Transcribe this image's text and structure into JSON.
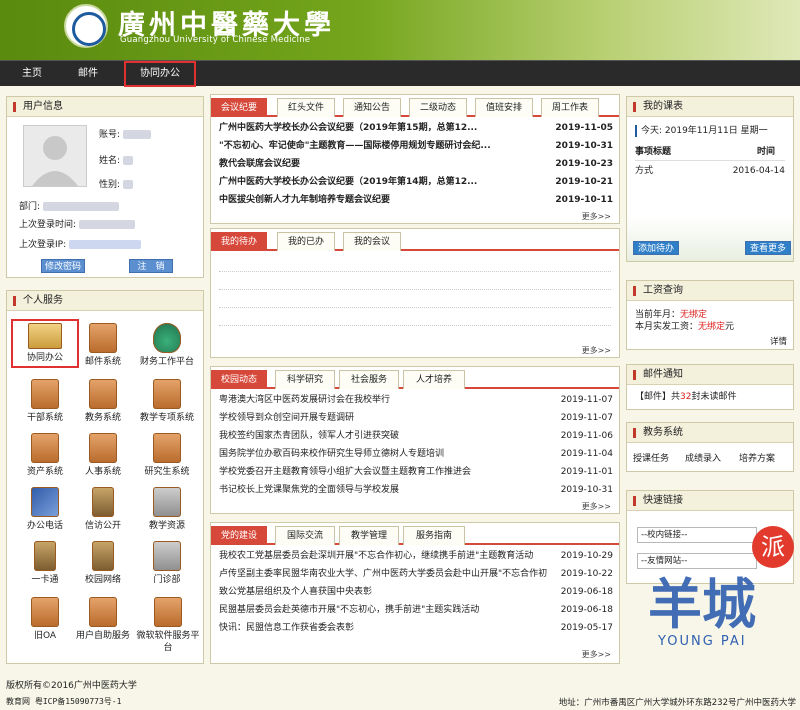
{
  "header": {
    "title_cn": "廣州中醫藥大學",
    "title_en": "Guangzhou University of Chinese Medicine"
  },
  "nav": {
    "items": [
      {
        "label": "主页"
      },
      {
        "label": "邮件"
      },
      {
        "label": "协同办公",
        "active": true
      }
    ]
  },
  "user_panel": {
    "title": "用户信息",
    "account_label": "账号:",
    "name_label": "姓名:",
    "gender_label": "性别:",
    "dept_label": "部门:",
    "last_login_time_label": "上次登录时间:",
    "last_login_ip_label": "上次登录IP:",
    "change_password": "修改密码",
    "logout": "注　销"
  },
  "services": {
    "title": "个人服务",
    "items": [
      {
        "label": "协同办公",
        "icon": "computer-icon"
      },
      {
        "label": "邮件系统",
        "icon": "mail-icon"
      },
      {
        "label": "财务工作平台",
        "icon": "money-bag-icon"
      },
      {
        "label": "干部系统",
        "icon": "folder-icon"
      },
      {
        "label": "教务系统",
        "icon": "folder-icon"
      },
      {
        "label": "教学专项系统",
        "icon": "folder-icon"
      },
      {
        "label": "资产系统",
        "icon": "folder-icon"
      },
      {
        "label": "人事系统",
        "icon": "folder-icon"
      },
      {
        "label": "研究生系统",
        "icon": "folder-icon"
      },
      {
        "label": "办公电话",
        "icon": "phone-book-icon"
      },
      {
        "label": "信访公开",
        "icon": "pen-holder-icon"
      },
      {
        "label": "教学资源",
        "icon": "resource-icon"
      },
      {
        "label": "一卡通",
        "icon": "card-icon"
      },
      {
        "label": "校园网络",
        "icon": "network-icon"
      },
      {
        "label": "门诊部",
        "icon": "clinic-icon"
      },
      {
        "label": "旧OA",
        "icon": "folder-icon"
      },
      {
        "label": "用户自助服务",
        "icon": "folder-icon"
      },
      {
        "label": "微软软件服务平台",
        "icon": "folder-icon"
      }
    ]
  },
  "news_panel": {
    "tabs": [
      "会议纪要",
      "红头文件",
      "通知公告",
      "二级动态",
      "值班安排",
      "周工作表"
    ],
    "rows": [
      {
        "title": "广州中医药大学校长办公会议纪要（2019年第15期，总第12...",
        "date": "2019-11-05",
        "bold": true
      },
      {
        "title": "\"不忘初心、牢记使命\"主题教育——国际楼停用规划专题研讨会纪...",
        "date": "2019-10-31",
        "bold": true
      },
      {
        "title": "教代会联席会议纪要",
        "date": "2019-10-23",
        "bold": true
      },
      {
        "title": "广州中医药大学校长办公会议纪要（2019年第14期，总第12...",
        "date": "2019-10-21",
        "bold": true
      },
      {
        "title": "中医拔尖创新人才九年制培养专题会议纪要",
        "date": "2019-10-11",
        "bold": true
      }
    ],
    "more": "更多>>"
  },
  "todo_panel": {
    "tabs": [
      "我的待办",
      "我的已办",
      "我的会议"
    ],
    "more": "更多>>"
  },
  "campus_panel": {
    "tabs": [
      "校园动态",
      "科学研究",
      "社会服务",
      "人才培养"
    ],
    "rows": [
      {
        "title": "粤港澳大湾区中医药发展研讨会在我校举行",
        "date": "2019-11-07"
      },
      {
        "title": "学校领导到众创空间开展专题调研",
        "date": "2019-11-07"
      },
      {
        "title": "我校签约国家杰青团队，领军人才引进获突破",
        "date": "2019-11-06"
      },
      {
        "title": "国务院学位办歌百码来校作研究生导师立德树人专题培训",
        "date": "2019-11-04"
      },
      {
        "title": "学校党委召开主题教育领导小组扩大会议暨主题教育工作推进会",
        "date": "2019-11-01"
      },
      {
        "title": "书记校长上党课聚焦党的全面领导与学校发展",
        "date": "2019-10-31"
      }
    ],
    "more": "更多>>"
  },
  "party_panel": {
    "tabs": [
      "党的建设",
      "国际交流",
      "教学管理",
      "服务指南"
    ],
    "rows": [
      {
        "title": "我校农工党基层委员会赴深圳开展\"不忘合作初心，继续携手前进\"主题教育活动",
        "date": "2019-10-29"
      },
      {
        "title": "卢传坚副主委率民盟华南农业大学、广州中医药大学委员会赴中山开展\"不忘合作初心，",
        "date": "2019-10-22"
      },
      {
        "title": "致公党基层组织及个人喜获国中央表彰",
        "date": "2019-06-18"
      },
      {
        "title": "民盟基层委员会赴英德市开展\"不忘初心，携手前进\"主题实践活动",
        "date": "2019-06-18"
      },
      {
        "title": "快讯：民盟信息工作获省委会表彰",
        "date": "2019-05-17"
      }
    ],
    "more": "更多>>"
  },
  "schedule_panel": {
    "title": "我的课表",
    "today_label": "今天: 2019年11月11日 星期一",
    "col_item": "事项标题",
    "col_time": "时间",
    "rows": [
      {
        "item": "方式",
        "time": "2016-04-14"
      }
    ],
    "add_btn": "添加待办",
    "more_btn": "查看更多"
  },
  "salary_panel": {
    "title": "工资查询",
    "month_label": "当前年月：",
    "month_value": "无绑定",
    "actual_label": "本月实发工资：",
    "actual_value": "无绑定",
    "unit": "元",
    "detail": "详情"
  },
  "mail_panel": {
    "title": "邮件通知",
    "prefix": "【邮件】共",
    "count": "32",
    "suffix": "封未读邮件"
  },
  "edu_panel": {
    "title": "教务系统",
    "links": [
      "授课任务",
      "成绩录入",
      "培养方案"
    ]
  },
  "quick_panel": {
    "title": "快速链接",
    "select1": "--校内链接--",
    "select2": "--友情网站--"
  },
  "footer": {
    "copyright": "版权所有©2016广州中医药大学",
    "icp": "教育网 粤ICP备15090773号-1",
    "address": "地址：广州市番禺区广州大学城外环东路232号广州中医药大学"
  },
  "watermark": {
    "text1": "羊城",
    "text2": "派",
    "text3": "YOUNG PAI"
  },
  "colors": {
    "accent": "#d6483a",
    "header_green": "#74a51c",
    "nav_dark": "#2a2a2a"
  }
}
